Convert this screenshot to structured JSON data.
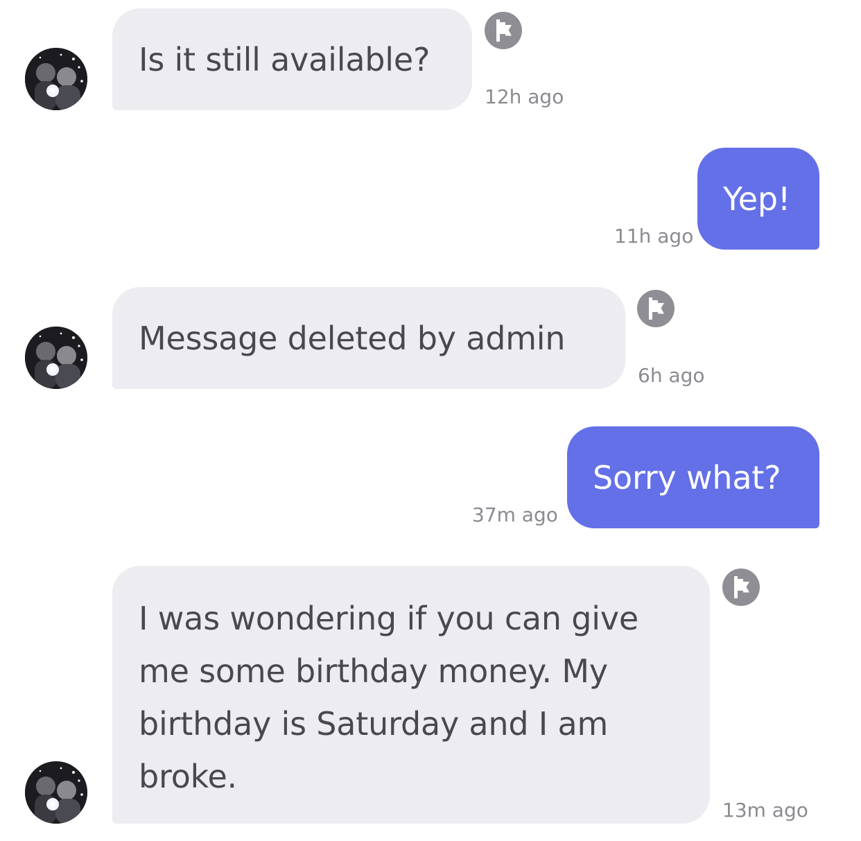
{
  "messages": [
    {
      "direction": "incoming",
      "text": "Is it still available?",
      "time": "12h ago",
      "has_flag": true
    },
    {
      "direction": "outgoing",
      "text": "Yep!",
      "time": "11h ago"
    },
    {
      "direction": "incoming",
      "text": "Message deleted by admin",
      "time": "6h ago",
      "has_flag": true
    },
    {
      "direction": "outgoing",
      "text": "Sorry what?",
      "time": "37m ago"
    },
    {
      "direction": "incoming",
      "text": "I was wondering if you can give\nme some birthday money. My\nbirthday is Saturday and I am\nbroke.",
      "time": "13m ago",
      "has_flag": true
    }
  ],
  "colors": {
    "incoming_bubble": "#ededf1",
    "incoming_text": "#48484e",
    "outgoing_bubble": "#6470e8",
    "outgoing_text": "#ffffff",
    "timestamp": "#8a8a90",
    "flag_icon": "#8e8e94"
  },
  "icons": {
    "report": "flag-icon",
    "sender": "avatar"
  }
}
